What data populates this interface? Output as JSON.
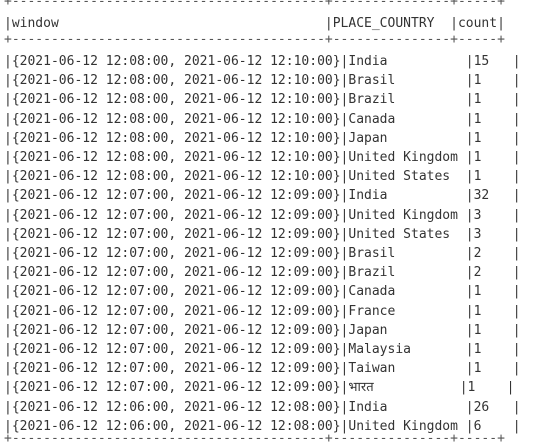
{
  "table": {
    "separator": "+----------------------------------------+---------------+-----+",
    "header": "|window                                  |PLACE_COUNTRY  |count|",
    "rows": [
      "|{2021-06-12 12:08:00, 2021-06-12 12:10:00}|India          |15   |",
      "|{2021-06-12 12:08:00, 2021-06-12 12:10:00}|Brasil         |1    |",
      "|{2021-06-12 12:08:00, 2021-06-12 12:10:00}|Brazil         |1    |",
      "|{2021-06-12 12:08:00, 2021-06-12 12:10:00}|Canada         |1    |",
      "|{2021-06-12 12:08:00, 2021-06-12 12:10:00}|Japan          |1    |",
      "|{2021-06-12 12:08:00, 2021-06-12 12:10:00}|United Kingdom |1    |",
      "|{2021-06-12 12:08:00, 2021-06-12 12:10:00}|United States  |1    |",
      "|{2021-06-12 12:07:00, 2021-06-12 12:09:00}|India          |32   |",
      "|{2021-06-12 12:07:00, 2021-06-12 12:09:00}|United Kingdom |3    |",
      "|{2021-06-12 12:07:00, 2021-06-12 12:09:00}|United States  |3    |",
      "|{2021-06-12 12:07:00, 2021-06-12 12:09:00}|Brasil         |2    |",
      "|{2021-06-12 12:07:00, 2021-06-12 12:09:00}|Brazil         |2    |",
      "|{2021-06-12 12:07:00, 2021-06-12 12:09:00}|Canada         |1    |",
      "|{2021-06-12 12:07:00, 2021-06-12 12:09:00}|France         |1    |",
      "|{2021-06-12 12:07:00, 2021-06-12 12:09:00}|Japan          |1    |",
      "|{2021-06-12 12:07:00, 2021-06-12 12:09:00}|Malaysia       |1    |",
      "|{2021-06-12 12:07:00, 2021-06-12 12:09:00}|Taiwan         |1    |",
      "|{2021-06-12 12:07:00, 2021-06-12 12:09:00}|भारत           |1    |",
      "|{2021-06-12 12:06:00, 2021-06-12 12:08:00}|India          |26   |",
      "|{2021-06-12 12:06:00, 2021-06-12 12:08:00}|United Kingdom |6    |"
    ]
  }
}
